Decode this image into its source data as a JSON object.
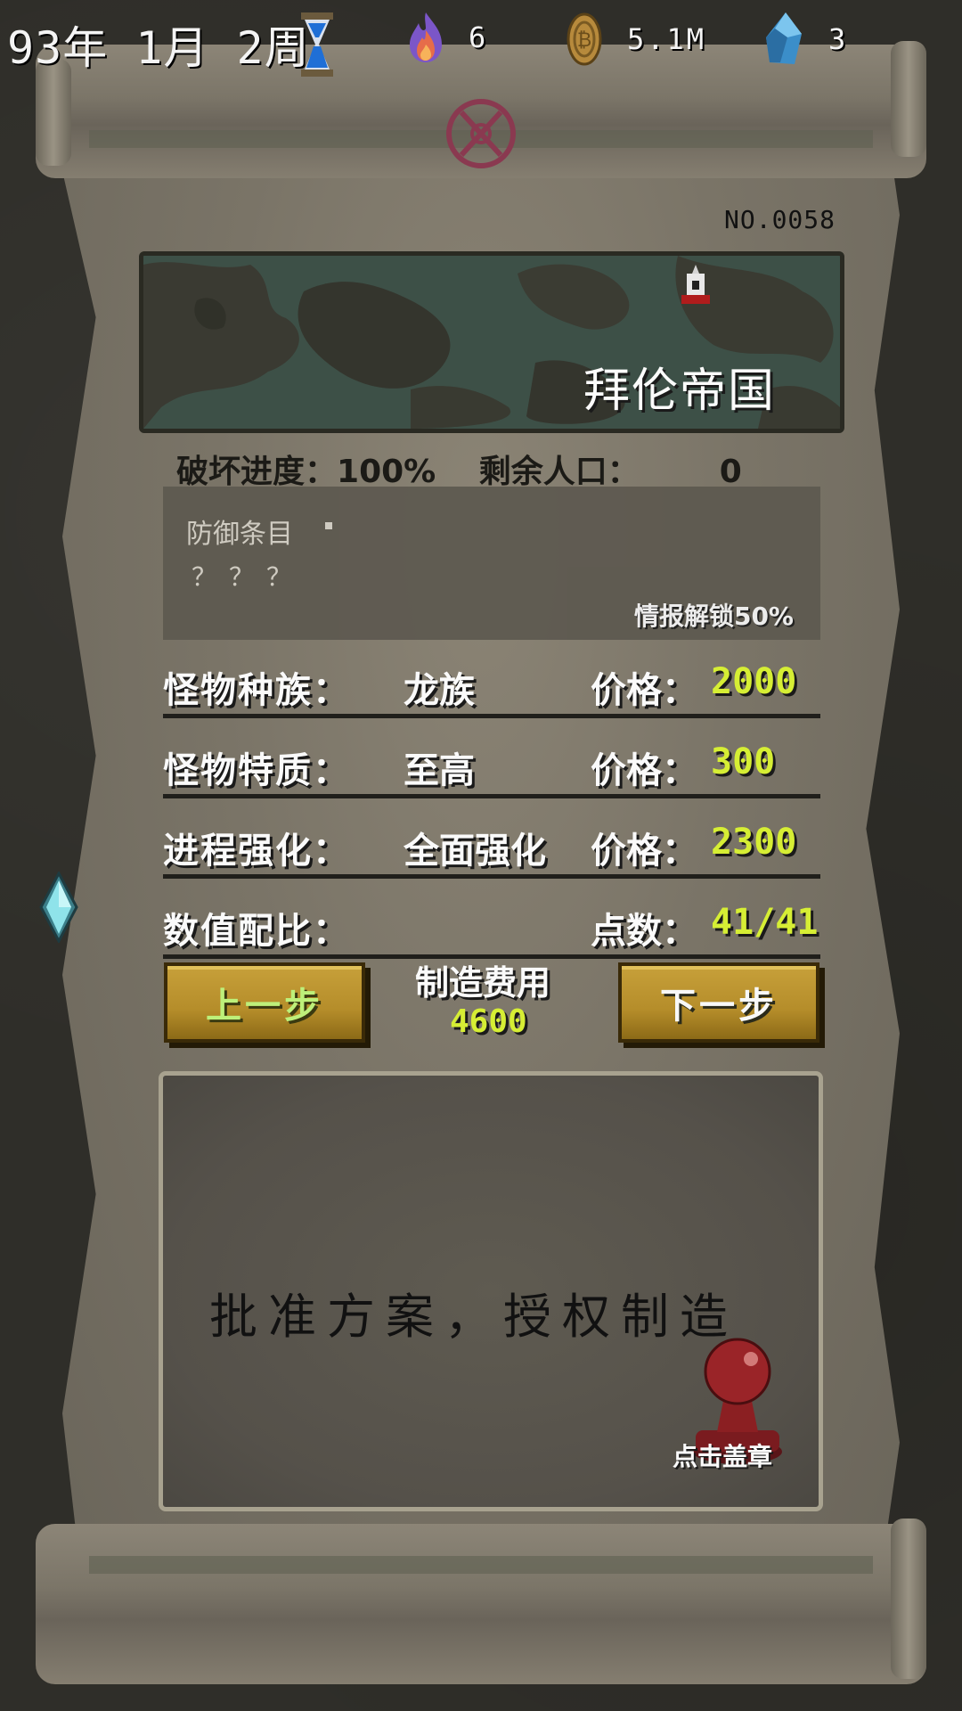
{
  "topbar": {
    "date": "93年 1月 2周",
    "fire_value": "6",
    "coin_value": "5.1M",
    "crystal_value": "3"
  },
  "document": {
    "serial": "NO.0058",
    "map_title": "拜伦帝国",
    "destroy_progress_label": "破坏进度：",
    "destroy_progress_value": "100%",
    "population_label": "剩余人口：",
    "population_value": "0",
    "defense_title": "防御条目",
    "defense_content": "？？？",
    "intel_unlock": "情报解锁50%"
  },
  "rows": [
    {
      "label": "怪物种族：",
      "value": "龙族",
      "price_label": "价格：",
      "price": "2000"
    },
    {
      "label": "怪物特质：",
      "value": "至高",
      "price_label": "价格：",
      "price": "300"
    },
    {
      "label": "进程强化：",
      "value": "全面强化",
      "price_label": "价格：",
      "price": "2300"
    },
    {
      "label": "数值配比：",
      "value": "",
      "price_label": "点数：",
      "price": "41/41"
    }
  ],
  "actions": {
    "prev_label": "上一步",
    "next_label": "下一步",
    "cost_label": "制造费用",
    "cost_value": "4600"
  },
  "approval": {
    "text": "批准方案，授权制造",
    "stamp_label": "点击盖章"
  },
  "colors": {
    "price": "#d6ee34",
    "button_gold": "#c7a03a",
    "stamp_red": "#8b1f22"
  },
  "icons": [
    "hourglass-icon",
    "fire-icon",
    "coin-icon",
    "crystal-icon",
    "seal-icon",
    "castle-marker-icon",
    "stamp-icon",
    "side-gem-icon"
  ]
}
